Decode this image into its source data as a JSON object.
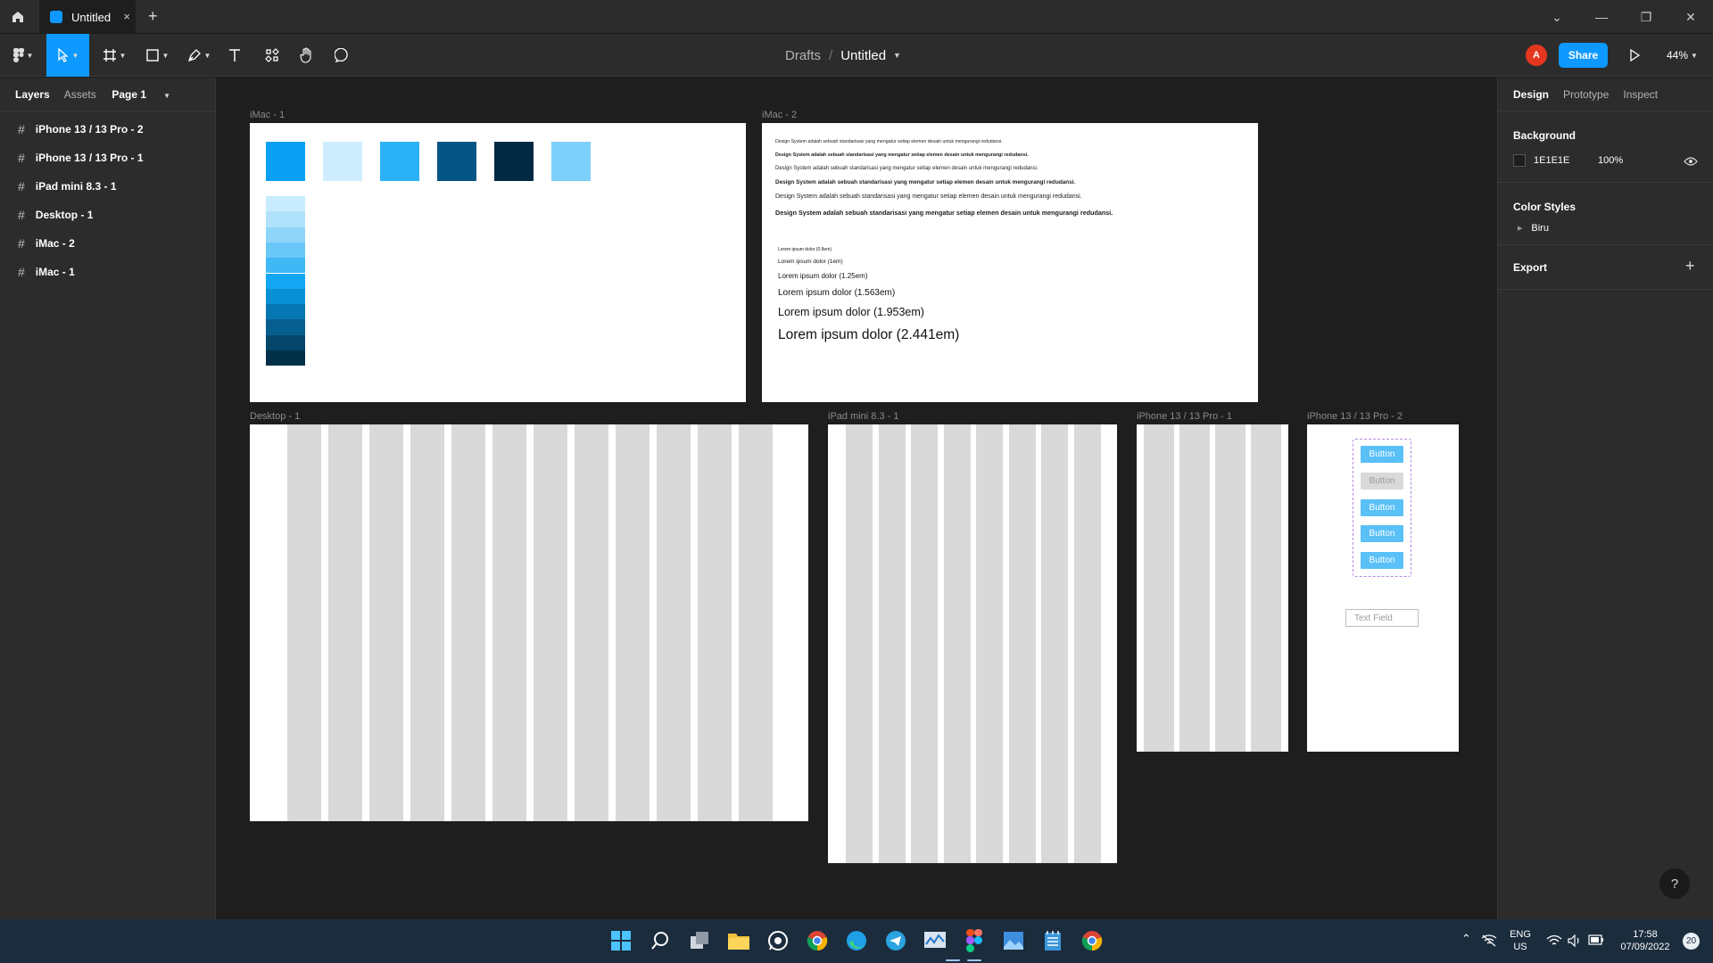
{
  "window": {
    "tab_title": "Untitled",
    "tab_close": "×",
    "new_tab": "+"
  },
  "toolbar": {
    "breadcrumb_parent": "Drafts",
    "breadcrumb_sep": "/",
    "file_name": "Untitled",
    "avatar_initial": "A",
    "share_label": "Share",
    "zoom_level": "44%",
    "accent_color": "#0d99ff"
  },
  "left_panel": {
    "tab_layers": "Layers",
    "tab_assets": "Assets",
    "page_selector": "Page 1",
    "layers": [
      "iPhone 13 / 13 Pro - 2",
      "iPhone 13 / 13 Pro - 1",
      "iPad mini 8.3 - 1",
      "Desktop - 1",
      "iMac - 2",
      "iMac - 1"
    ]
  },
  "canvas": {
    "frames": {
      "imac1": "iMac - 1",
      "imac2": "iMac - 2",
      "desktop1": "Desktop - 1",
      "ipad1": "iPad mini 8.3 - 1",
      "iphone1": "iPhone 13 / 13 Pro - 1",
      "iphone2": "iPhone 13 / 13 Pro - 2"
    },
    "palette_swatches": [
      "#0aa1f5",
      "#cfeefd",
      "#2bb1f7",
      "#055584",
      "#032a45",
      "#7cd0fb"
    ],
    "scale_swatches": [
      "#c8ecfd",
      "#b0e2fb",
      "#8fd5fa",
      "#6ac8f8",
      "#3fb8f6",
      "#12a6f3",
      "#0890d6",
      "#0677b3",
      "#055e8e",
      "#04466a",
      "#033049"
    ],
    "design_system_lines": [
      "Design System adalah sebuah standarisasi yang mengatur setiap elemen desain untuk mengurangi redudansi.",
      "Design System adalah sebuah standarisasi yang mengatur setiap elemen desain untuk mengurangi redudansi.",
      "Design System adalah sebuah standarisasi yang mengatur setiap elemen desain untuk mengurangi redudansi.",
      "Design System adalah sebuah standarisasi yang mengatur setiap elemen desain untuk mengurangi redudansi.",
      "Design System adalah sebuah standarisasi yang mengatur setiap elemen desain untuk mengurangi redudansi.",
      "Design System adalah sebuah standarisasi yang mengatur setiap elemen desain untuk mengurangi redudansi."
    ],
    "type_scale": [
      "Lorem ipsum dolor (0.8em)",
      "Lorem ipsum dolor (1em)",
      "Lorem ipsum dolor (1.25em)",
      "Lorem ipsum dolor (1.563em)",
      "Lorem ipsum dolor (1.953em)",
      "Lorem ipsum dolor (2.441em)"
    ],
    "buttons": [
      "Button",
      "Button",
      "Button",
      "Button",
      "Button"
    ],
    "text_field_placeholder": "Text Field"
  },
  "right_panel": {
    "tab_design": "Design",
    "tab_prototype": "Prototype",
    "tab_inspect": "Inspect",
    "background_title": "Background",
    "background_hex": "1E1E1E",
    "background_opacity": "100%",
    "color_styles_title": "Color Styles",
    "color_style_name": "Biru",
    "export_title": "Export",
    "help": "?"
  },
  "taskbar": {
    "lang_top": "ENG",
    "lang_bottom": "US",
    "time": "17:58",
    "date": "07/09/2022",
    "notifications": "20"
  }
}
